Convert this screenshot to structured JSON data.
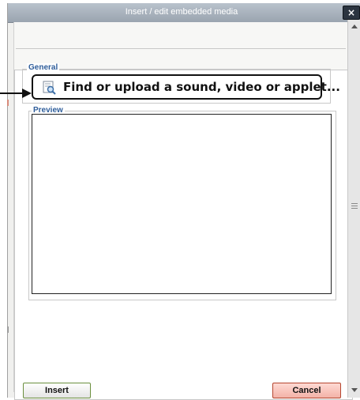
{
  "dialog": {
    "title": "Insert / edit embedded media",
    "close_label": "×"
  },
  "general": {
    "legend": "General",
    "find_button_label": "Find or upload a sound, video or applet..."
  },
  "preview": {
    "legend": "Preview"
  },
  "buttons": {
    "insert_label": "Insert",
    "cancel_label": "Cancel"
  },
  "icons": {
    "find": "media-search-icon",
    "close": "close-icon",
    "annotation": "arrow-right-icon"
  }
}
